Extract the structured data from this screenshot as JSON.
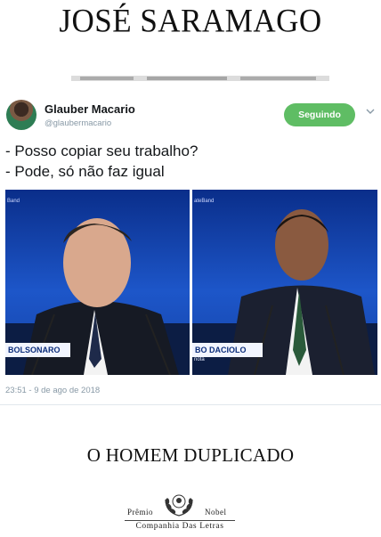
{
  "cover": {
    "author": "JOSÉ SARAMAGO",
    "book_title": "O HOMEM DUPLICADO",
    "publisher_award_left": "Prêmio",
    "publisher_award_right": "Nobel",
    "publisher_name": "Companhia Das Letras"
  },
  "tweet": {
    "user_name": "Glauber Macario",
    "user_handle": "@glaubermacario",
    "follow_label": "Seguindo",
    "text_line_1": "- Posso copiar seu trabalho?",
    "text_line_2": "- Pode, só não faz igual",
    "timestamp": "23:51 - 9 de ago de 2018",
    "media": {
      "left_panel": {
        "corner_tag": "Band",
        "lower_third": "BOLSONARO"
      },
      "right_panel": {
        "corner_tag": "ateBand",
        "lower_third": "BO DACIOLO",
        "lower_sub": "riota"
      }
    }
  },
  "colors": {
    "follow_button": "#5fbd64",
    "muted_text": "#8899a6",
    "studio_blue": "#1d56c9"
  }
}
